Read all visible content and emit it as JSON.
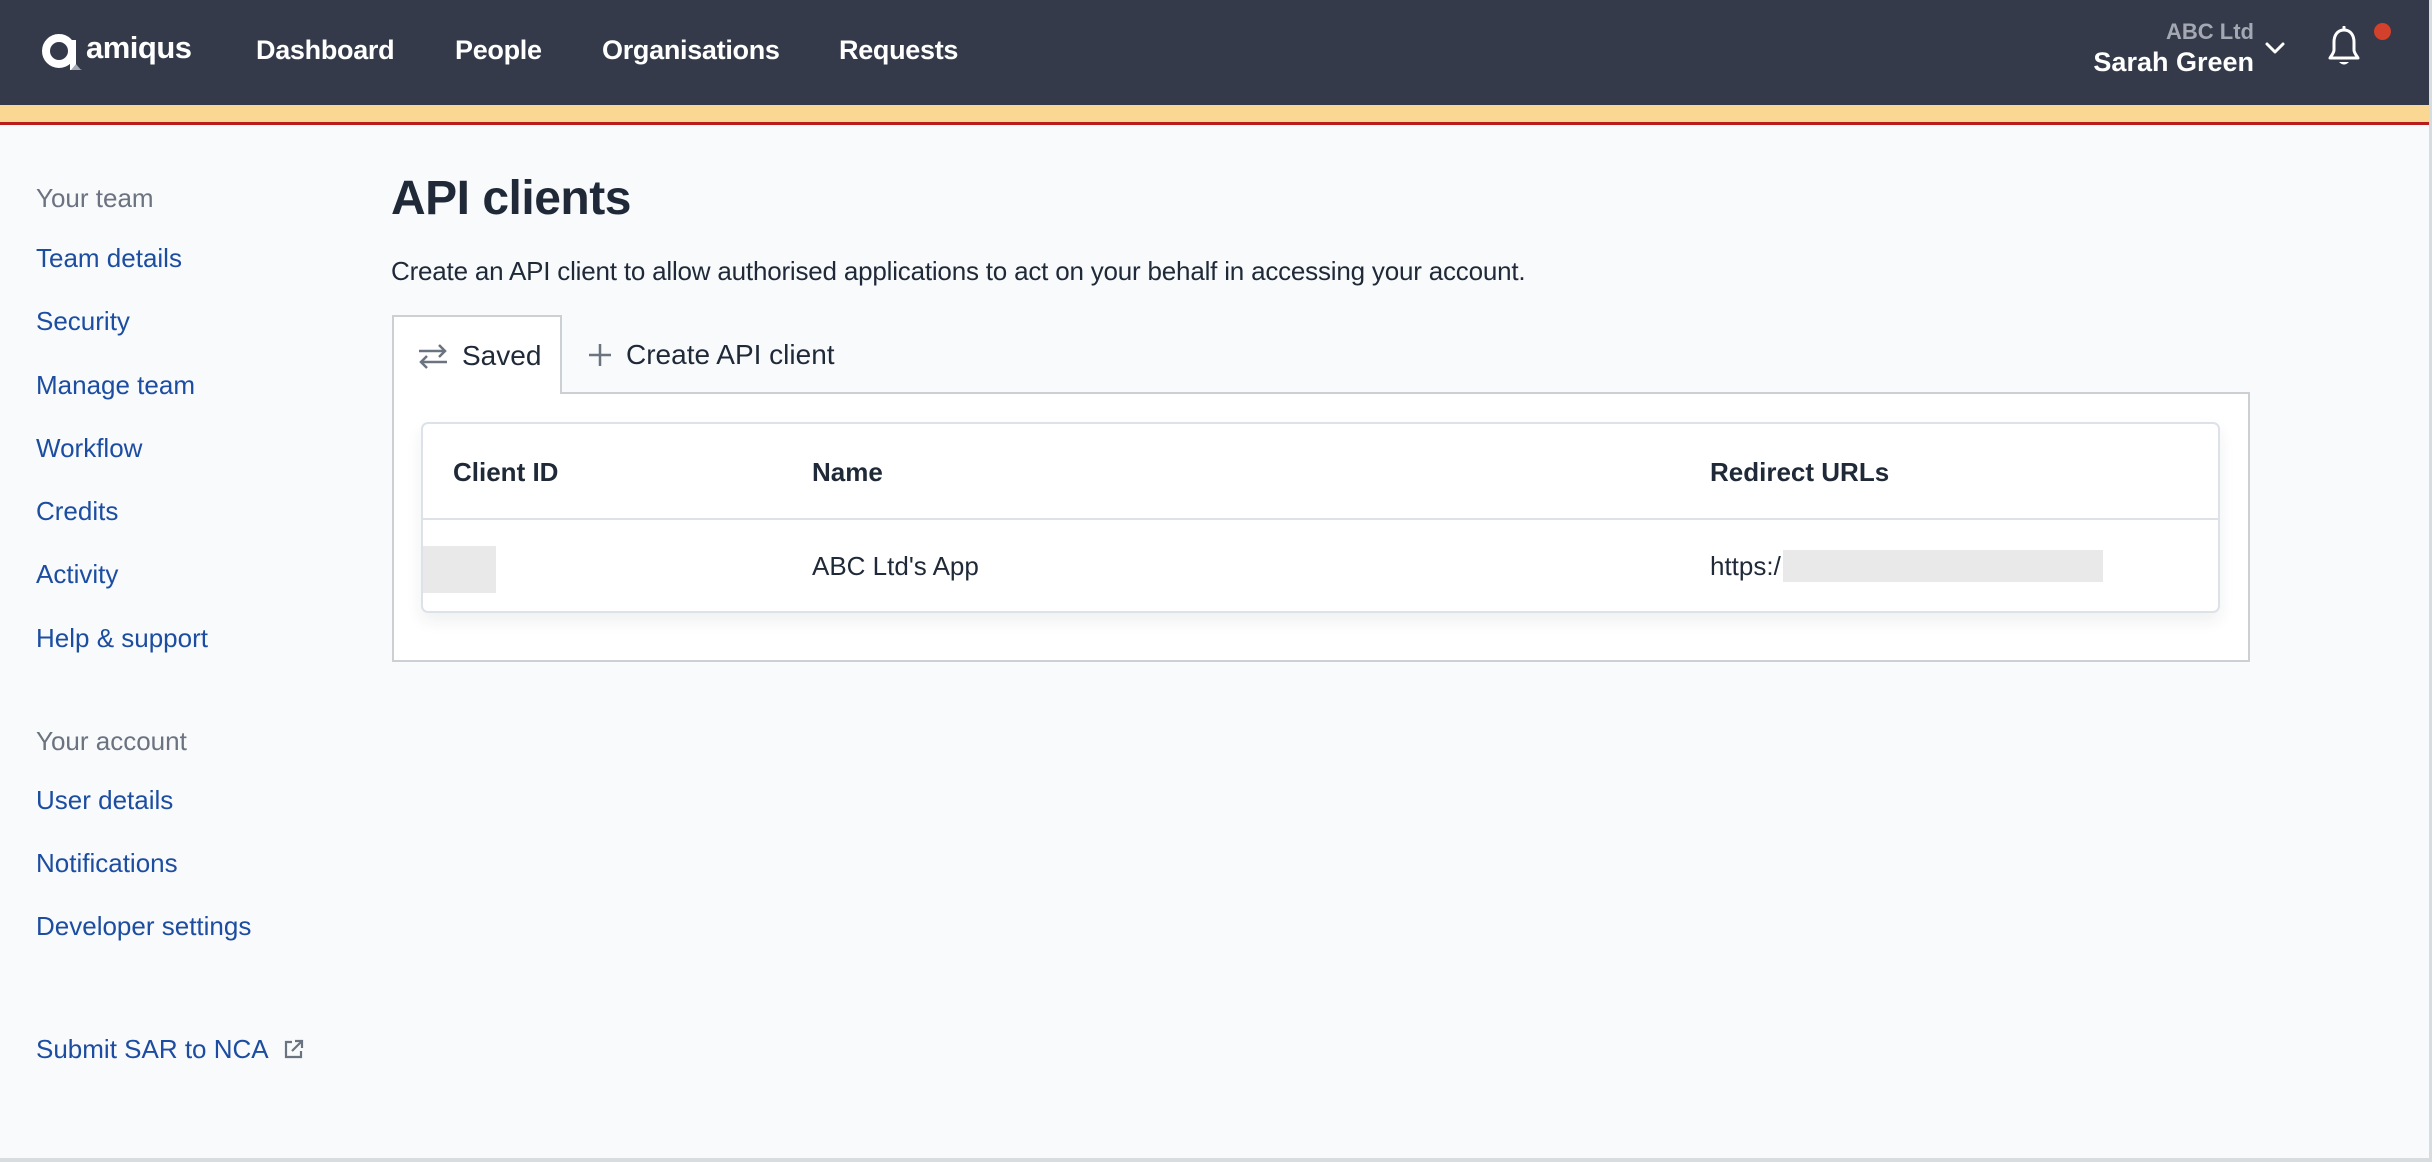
{
  "navbar": {
    "logo_text": "amiqus",
    "links": [
      {
        "label": "Dashboard"
      },
      {
        "label": "People"
      },
      {
        "label": "Organisations"
      },
      {
        "label": "Requests"
      }
    ],
    "account": {
      "organisation": "ABC Ltd",
      "user_name": "Sarah Green"
    },
    "notification_dot_color": "#d3412c",
    "icons": [
      "chevron-down-icon",
      "bell-icon"
    ]
  },
  "banner": {
    "color": "#fbd794",
    "border_color": "#b81c1c"
  },
  "sidebar": {
    "sections": [
      {
        "heading": "Your team",
        "items": [
          {
            "label": "Team details"
          },
          {
            "label": "Security"
          },
          {
            "label": "Manage team"
          },
          {
            "label": "Workflow"
          },
          {
            "label": "Credits"
          },
          {
            "label": "Activity"
          },
          {
            "label": "Help & support"
          }
        ]
      },
      {
        "heading": "Your account",
        "items": [
          {
            "label": "User details"
          },
          {
            "label": "Notifications"
          },
          {
            "label": "Developer settings"
          }
        ]
      }
    ],
    "external_link": {
      "label": "Submit SAR to NCA",
      "icon": "external-link-icon"
    }
  },
  "main": {
    "title": "API clients",
    "description": "Create an API client to allow authorised applications to act on your behalf in accessing your account.",
    "tabs": [
      {
        "label": "Saved",
        "icon": "swap-arrows-icon",
        "active": true
      },
      {
        "label": "Create API client",
        "icon": "plus-icon",
        "active": false
      }
    ],
    "table": {
      "columns": [
        "Client ID",
        "Name",
        "Redirect URLs"
      ],
      "rows": [
        {
          "client_id": "[redacted]",
          "name": "ABC Ltd's App",
          "redirect_url_prefix": "https:/",
          "redirect_url_rest": "[redacted]"
        }
      ]
    }
  },
  "colors": {
    "nav_bg": "#343a4a",
    "link": "#1c4da1",
    "muted": "#6b7280",
    "page_bg": "#f8fafc"
  }
}
